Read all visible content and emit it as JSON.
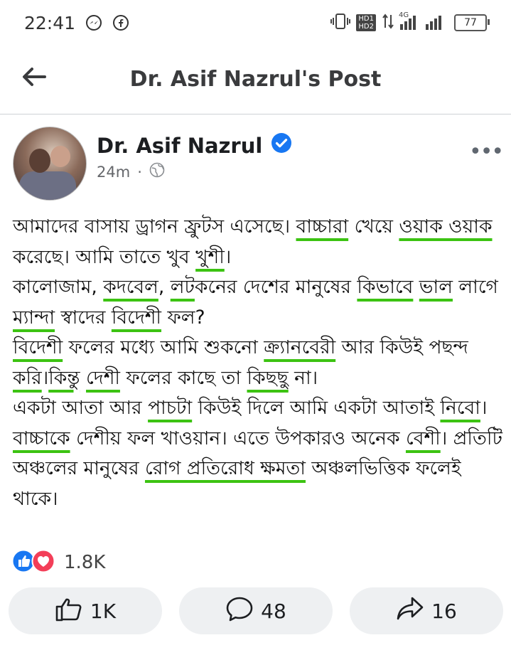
{
  "status_bar": {
    "time": "22:41",
    "left_icons": [
      "messenger-icon",
      "facebook-icon"
    ],
    "hd_badges": [
      "HD1",
      "HD2"
    ],
    "network": "4G",
    "battery": "77"
  },
  "header": {
    "title": "Dr. Asif Nazrul's Post",
    "back_icon": "arrow-left-icon"
  },
  "post": {
    "author": "Dr. Asif Nazrul",
    "verified_icon": "verified-badge-icon",
    "time": "24m",
    "separator": "·",
    "privacy_icon": "globe-icon",
    "more_label": "•••",
    "paragraphs": [
      [
        "আমাদের বাসায় ড্রাগন ফ্রুটস এসেছে। ",
        {
          "u": "বাচ্চারা"
        },
        " খেয়ে ",
        {
          "u": "ওয়াক ওয়াক"
        },
        " করেছে। আমি তাতে খুব ",
        {
          "u": "খুশী"
        },
        "।"
      ],
      [
        "কালোজাম, ",
        {
          "u": "কদবেল"
        },
        ", ",
        {
          "u": "লট"
        },
        "কনের দেশের মানুষের ",
        {
          "u": "কিভাবে"
        },
        " ",
        {
          "u": "ভাল"
        },
        " লাগে ",
        {
          "u": "ম্যান্দা"
        },
        " স্বাদের ",
        {
          "u": "বিদেশী"
        },
        " ফল?"
      ],
      [
        {
          "u": "বিদেশী"
        },
        " ফলের মধ্যে আমি শুকনো ",
        {
          "u": "ক্র্যানবেরী"
        },
        " আর কিউই পছন্দ ",
        {
          "u": "করি"
        },
        "।",
        {
          "u": "কিন্তু"
        },
        " ",
        {
          "u": "দেশী"
        },
        " ফলের কাছে তা ",
        {
          "u": "কিছছু"
        },
        " না।"
      ],
      [
        "একটা আতা আর ",
        {
          "u": "পাচটা"
        },
        " কিউই দিলে আমি একটা আতাই ",
        {
          "u": "নিবো"
        },
        "।"
      ],
      [
        {
          "u": "বাচ্চাকে"
        },
        " দেশীয় ফল খাওয়ান। এতে উপকারও অনেক ",
        {
          "u": "বেশী"
        },
        "। প্রতিটি অঞ্চলের মানুষের ",
        {
          "u": "রোগ প্রতিরোধ ক্ষমতা"
        },
        " অঞ্চলভিত্তিক ফলেই থাকে।"
      ]
    ]
  },
  "reactions": {
    "icons": [
      "like-reaction-icon",
      "love-reaction-icon"
    ],
    "count": "1.8K"
  },
  "actions": {
    "like": {
      "icon": "thumbs-up-icon",
      "count": "1K"
    },
    "comment": {
      "icon": "comment-bubble-icon",
      "count": "48"
    },
    "share": {
      "icon": "share-arrow-icon",
      "count": "16"
    }
  },
  "colors": {
    "facebook_blue": "#1877f2",
    "love_red": "#f33e58",
    "underline_green": "#3cc312",
    "action_bg": "#eef0f2"
  }
}
